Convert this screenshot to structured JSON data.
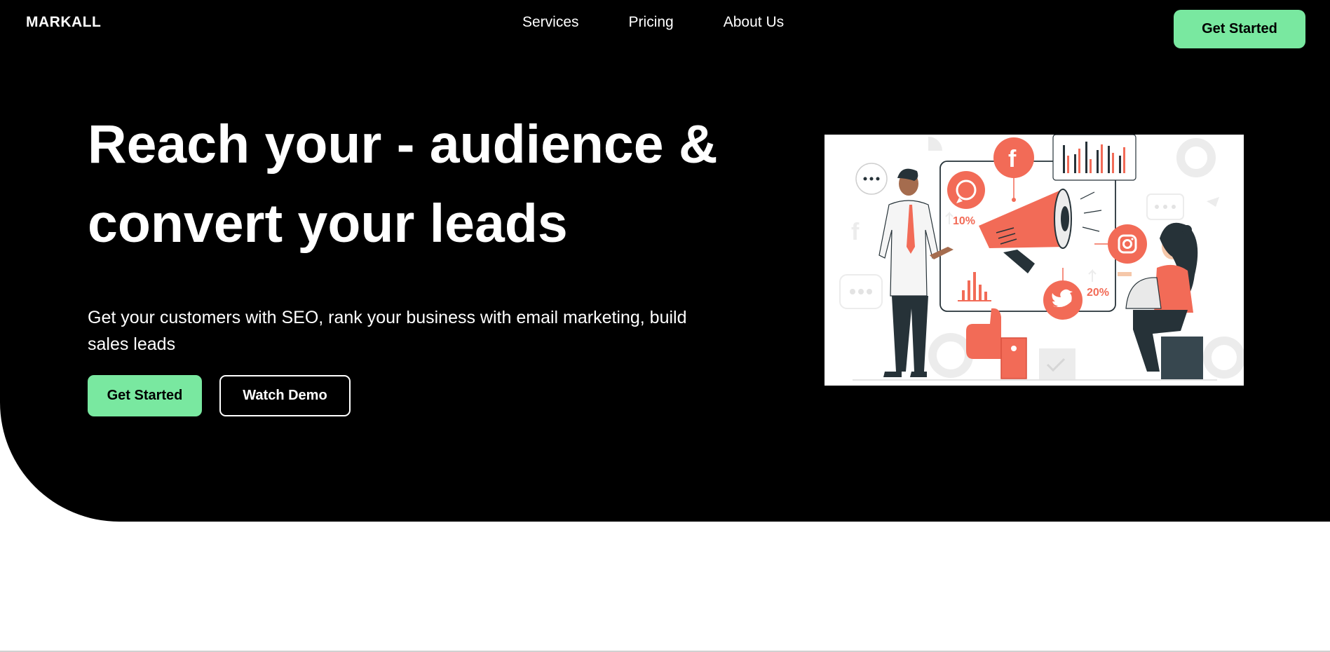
{
  "brand": {
    "name": "MARKALL"
  },
  "nav": {
    "items": [
      "Services",
      "Pricing",
      "About Us"
    ],
    "cta_label": "Get Started"
  },
  "hero": {
    "headline": "Reach your - audience & convert your leads",
    "subtitle": "Get your customers with SEO, rank your business with email marketing, build sales leads",
    "primary_button": "Get Started",
    "secondary_button": "Watch Demo",
    "illustration": {
      "stat_left": "10%",
      "stat_right": "20%",
      "icons": [
        "whatsapp-icon",
        "facebook-icon",
        "instagram-icon",
        "twitter-icon",
        "megaphone-icon",
        "thumbs-up-icon",
        "bar-chart-icon",
        "chat-bubble-icon"
      ]
    }
  },
  "colors": {
    "accent": "#79e8a0",
    "hero_bg": "#000000",
    "illustration_accent": "#f26b57",
    "illustration_dark": "#263238"
  }
}
